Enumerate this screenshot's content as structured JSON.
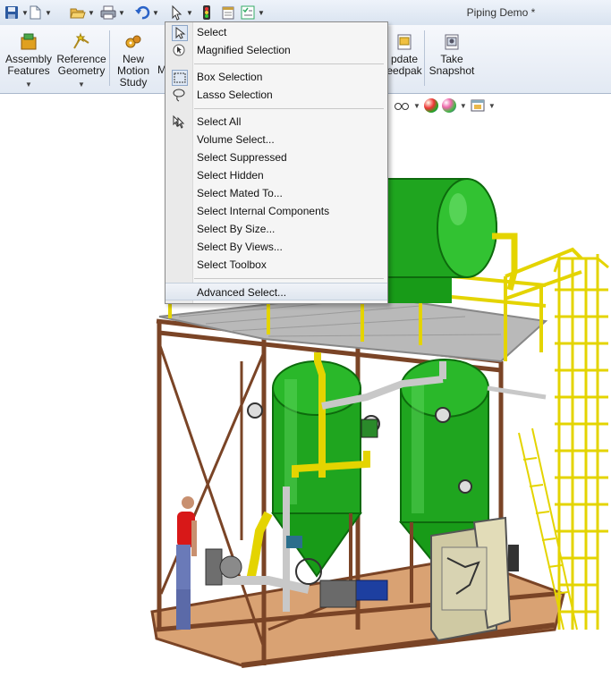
{
  "window": {
    "title": "Piping Demo *"
  },
  "quick_access": {
    "icons": [
      "save-icon",
      "new-document-icon",
      "open-folder-icon",
      "print-icon",
      "undo-icon",
      "select-pointer-icon",
      "rebuild-traffic-light-icon",
      "file-properties-icon",
      "options-checklist-icon"
    ]
  },
  "ribbon": {
    "assembly_features": {
      "line1": "Assembly",
      "line2": "Features"
    },
    "reference_geometry": {
      "line1": "Reference",
      "line2": "Geometry"
    },
    "new_motion_study": {
      "line1": "New",
      "line2": "Motion",
      "line3": "Study"
    },
    "update_speedpak": {
      "line1": "pdate",
      "line2": "eedpak"
    },
    "take_snapshot": {
      "line1": "Take",
      "line2": "Snapshot"
    },
    "partial_m": "M"
  },
  "select_menu": {
    "group1": [
      "Select",
      "Magnified Selection"
    ],
    "group2": [
      "Box Selection",
      "Lasso Selection"
    ],
    "group3": [
      "Select All",
      "Volume Select...",
      "Select Suppressed",
      "Select Hidden",
      "Select Mated To...",
      "Select Internal Components",
      "Select By Size...",
      "Select By Views...",
      "Select Toolbox"
    ],
    "group4": [
      "Advanced Select..."
    ],
    "highlighted": "Advanced Select..."
  },
  "colors": {
    "tank_green": "#1fa51f",
    "frame_brown": "#7a4426",
    "rail_yellow": "#e4d400",
    "floor_tan": "#d9a273",
    "panel_beige": "#cfc9a3"
  }
}
